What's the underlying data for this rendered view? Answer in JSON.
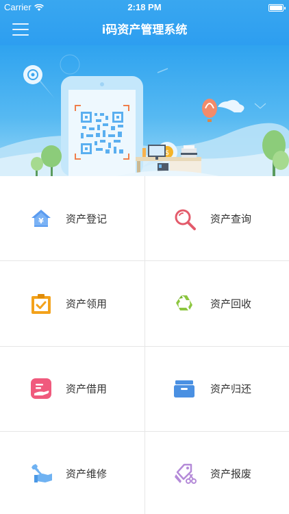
{
  "status_bar": {
    "carrier": "Carrier",
    "time": "2:18 PM"
  },
  "nav": {
    "title": "i码资产管理系统"
  },
  "menu": [
    {
      "label": "资产登记",
      "icon": "house-yen-icon",
      "color": "#5a9bf0"
    },
    {
      "label": "资产查询",
      "icon": "magnifier-icon",
      "color": "#e35b6b"
    },
    {
      "label": "资产领用",
      "icon": "clipboard-check-icon",
      "color": "#f3a21b"
    },
    {
      "label": "资产回收",
      "icon": "recycle-icon",
      "color": "#8cc63f"
    },
    {
      "label": "资产借用",
      "icon": "hand-document-icon",
      "color": "#f05a7d"
    },
    {
      "label": "资产归还",
      "icon": "drawer-icon",
      "color": "#4a90e2"
    },
    {
      "label": "资产维修",
      "icon": "wrench-hand-icon",
      "color": "#6fb2f2"
    },
    {
      "label": "资产报废",
      "icon": "tag-scissors-icon",
      "color": "#b48ad8"
    }
  ],
  "colors": {
    "nav_blue": "#2d9ef0",
    "divider": "#e6e6e6"
  }
}
